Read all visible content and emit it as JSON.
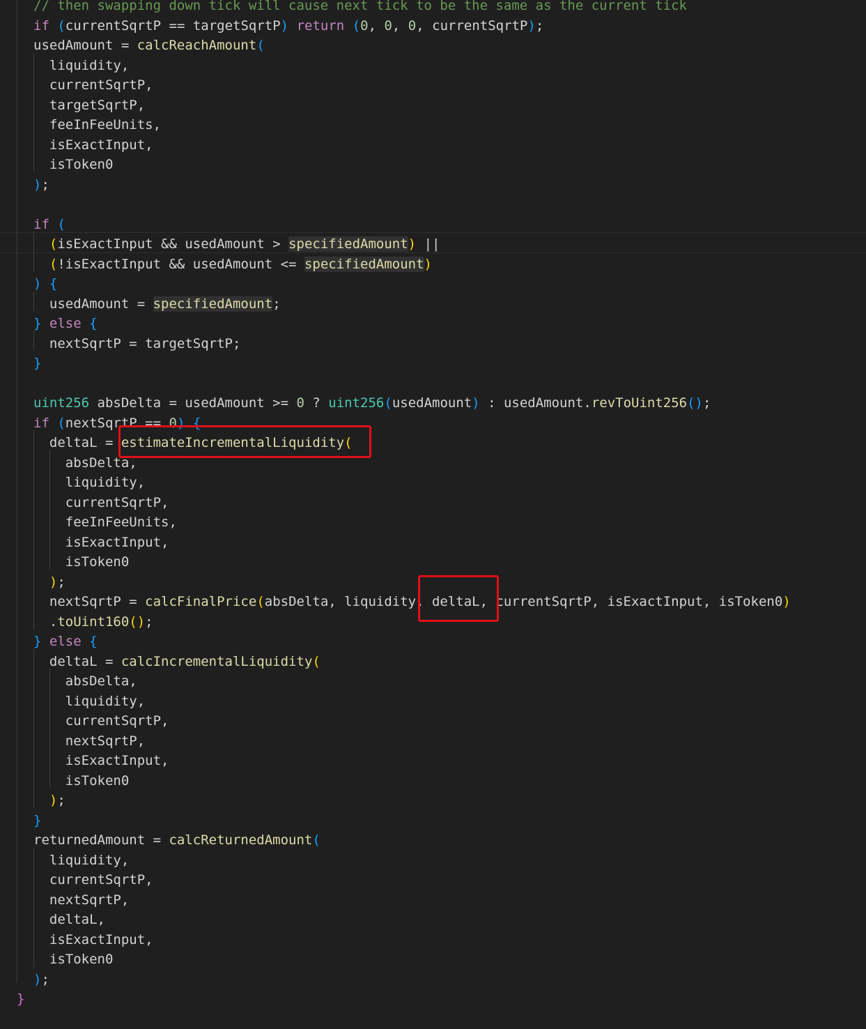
{
  "colors": {
    "background": "#1f1f1f",
    "keyword": "#c586c0",
    "function": "#dcdcaa",
    "type": "#4ec9b0",
    "number": "#b5cea8",
    "comment": "#6a9955",
    "bracket_level1": "#ffd700",
    "bracket_level2": "#da70d6",
    "bracket_level3": "#179fff",
    "annotation_box": "#e0101a"
  },
  "code": {
    "lines": [
      [
        {
          "t": "cmt",
          "v": "// then swapping down tick will cause next tick to be the same as the current tick"
        }
      ],
      [
        {
          "t": "kw",
          "v": "if"
        },
        {
          "t": "txt",
          "v": " "
        },
        {
          "t": "b3",
          "v": "("
        },
        {
          "t": "txt",
          "v": "currentSqrtP == targetSqrtP"
        },
        {
          "t": "b3",
          "v": ")"
        },
        {
          "t": "txt",
          "v": " "
        },
        {
          "t": "kw",
          "v": "return"
        },
        {
          "t": "txt",
          "v": " "
        },
        {
          "t": "b3",
          "v": "("
        },
        {
          "t": "num",
          "v": "0"
        },
        {
          "t": "txt",
          "v": ", "
        },
        {
          "t": "num",
          "v": "0"
        },
        {
          "t": "txt",
          "v": ", "
        },
        {
          "t": "num",
          "v": "0"
        },
        {
          "t": "txt",
          "v": ", currentSqrtP"
        },
        {
          "t": "b3",
          "v": ")"
        },
        {
          "t": "txt",
          "v": ";"
        }
      ],
      [
        {
          "t": "txt",
          "v": "usedAmount = "
        },
        {
          "t": "fn",
          "v": "calcReachAmount"
        },
        {
          "t": "b3",
          "v": "("
        }
      ],
      [
        {
          "t": "txt",
          "v": "  liquidity,"
        }
      ],
      [
        {
          "t": "txt",
          "v": "  currentSqrtP,"
        }
      ],
      [
        {
          "t": "txt",
          "v": "  targetSqrtP,"
        }
      ],
      [
        {
          "t": "txt",
          "v": "  feeInFeeUnits,"
        }
      ],
      [
        {
          "t": "txt",
          "v": "  isExactInput,"
        }
      ],
      [
        {
          "t": "txt",
          "v": "  isToken0"
        }
      ],
      [
        {
          "t": "b3",
          "v": ")"
        },
        {
          "t": "txt",
          "v": ";"
        }
      ],
      [],
      [
        {
          "t": "kw",
          "v": "if"
        },
        {
          "t": "txt",
          "v": " "
        },
        {
          "t": "b3",
          "v": "("
        }
      ],
      [
        {
          "t": "txt",
          "v": "  "
        },
        {
          "t": "b1",
          "v": "("
        },
        {
          "t": "txt",
          "v": "isExactInput && usedAmount > "
        },
        {
          "t": "mark",
          "v": "specifiedAmount"
        },
        {
          "t": "b1",
          "v": ")"
        },
        {
          "t": "txt",
          "v": " ||"
        }
      ],
      [
        {
          "t": "txt",
          "v": "  "
        },
        {
          "t": "b1",
          "v": "("
        },
        {
          "t": "txt",
          "v": "!isExactInput && usedAmount <= "
        },
        {
          "t": "mark",
          "v": "specifiedAmount"
        },
        {
          "t": "b1",
          "v": ")"
        }
      ],
      [
        {
          "t": "b3",
          "v": ")"
        },
        {
          "t": "txt",
          "v": " "
        },
        {
          "t": "b3",
          "v": "{"
        }
      ],
      [
        {
          "t": "txt",
          "v": "  usedAmount = "
        },
        {
          "t": "mark",
          "v": "specifiedAmount"
        },
        {
          "t": "txt",
          "v": ";"
        }
      ],
      [
        {
          "t": "b3",
          "v": "}"
        },
        {
          "t": "txt",
          "v": " "
        },
        {
          "t": "kw",
          "v": "else"
        },
        {
          "t": "txt",
          "v": " "
        },
        {
          "t": "b3",
          "v": "{"
        }
      ],
      [
        {
          "t": "txt",
          "v": "  nextSqrtP = targetSqrtP;"
        }
      ],
      [
        {
          "t": "b3",
          "v": "}"
        }
      ],
      [],
      [
        {
          "t": "type",
          "v": "uint256"
        },
        {
          "t": "txt",
          "v": " absDelta = usedAmount >= "
        },
        {
          "t": "num",
          "v": "0"
        },
        {
          "t": "txt",
          "v": " ? "
        },
        {
          "t": "type",
          "v": "uint256"
        },
        {
          "t": "b3",
          "v": "("
        },
        {
          "t": "txt",
          "v": "usedAmount"
        },
        {
          "t": "b3",
          "v": ")"
        },
        {
          "t": "txt",
          "v": " : usedAmount."
        },
        {
          "t": "fn",
          "v": "revToUint256"
        },
        {
          "t": "b3",
          "v": "()"
        },
        {
          "t": "txt",
          "v": ";"
        }
      ],
      [
        {
          "t": "kw",
          "v": "if"
        },
        {
          "t": "txt",
          "v": " "
        },
        {
          "t": "b3",
          "v": "("
        },
        {
          "t": "txt",
          "v": "nextSqrtP == "
        },
        {
          "t": "num",
          "v": "0"
        },
        {
          "t": "b3",
          "v": ")"
        },
        {
          "t": "txt",
          "v": " "
        },
        {
          "t": "b3",
          "v": "{"
        }
      ],
      [
        {
          "t": "txt",
          "v": "  deltaL = "
        },
        {
          "t": "fn",
          "v": "estimateIncrementalLiquidity"
        },
        {
          "t": "b1",
          "v": "("
        }
      ],
      [
        {
          "t": "txt",
          "v": "    absDelta,"
        }
      ],
      [
        {
          "t": "txt",
          "v": "    liquidity,"
        }
      ],
      [
        {
          "t": "txt",
          "v": "    currentSqrtP,"
        }
      ],
      [
        {
          "t": "txt",
          "v": "    feeInFeeUnits,"
        }
      ],
      [
        {
          "t": "txt",
          "v": "    isExactInput,"
        }
      ],
      [
        {
          "t": "txt",
          "v": "    isToken0"
        }
      ],
      [
        {
          "t": "txt",
          "v": "  "
        },
        {
          "t": "b1",
          "v": ")"
        },
        {
          "t": "txt",
          "v": ";"
        }
      ],
      [
        {
          "t": "txt",
          "v": "  nextSqrtP = "
        },
        {
          "t": "fn",
          "v": "calcFinalPrice"
        },
        {
          "t": "b1",
          "v": "("
        },
        {
          "t": "txt",
          "v": "absDelta, liquidity, deltaL, currentSqrtP, isExactInput, isToken0"
        },
        {
          "t": "b1",
          "v": ")"
        }
      ],
      [
        {
          "t": "txt",
          "v": "  ."
        },
        {
          "t": "fn",
          "v": "toUint160"
        },
        {
          "t": "b1",
          "v": "()"
        },
        {
          "t": "txt",
          "v": ";"
        }
      ],
      [
        {
          "t": "b3",
          "v": "}"
        },
        {
          "t": "txt",
          "v": " "
        },
        {
          "t": "kw",
          "v": "else"
        },
        {
          "t": "txt",
          "v": " "
        },
        {
          "t": "b3",
          "v": "{"
        }
      ],
      [
        {
          "t": "txt",
          "v": "  deltaL = "
        },
        {
          "t": "fn",
          "v": "calcIncrementalLiquidity"
        },
        {
          "t": "b1",
          "v": "("
        }
      ],
      [
        {
          "t": "txt",
          "v": "    absDelta,"
        }
      ],
      [
        {
          "t": "txt",
          "v": "    liquidity,"
        }
      ],
      [
        {
          "t": "txt",
          "v": "    currentSqrtP,"
        }
      ],
      [
        {
          "t": "txt",
          "v": "    nextSqrtP,"
        }
      ],
      [
        {
          "t": "txt",
          "v": "    isExactInput,"
        }
      ],
      [
        {
          "t": "txt",
          "v": "    isToken0"
        }
      ],
      [
        {
          "t": "txt",
          "v": "  "
        },
        {
          "t": "b1",
          "v": ")"
        },
        {
          "t": "txt",
          "v": ";"
        }
      ],
      [
        {
          "t": "b3",
          "v": "}"
        }
      ],
      [
        {
          "t": "txt",
          "v": "returnedAmount = "
        },
        {
          "t": "fn",
          "v": "calcReturnedAmount"
        },
        {
          "t": "b3",
          "v": "("
        }
      ],
      [
        {
          "t": "txt",
          "v": "  liquidity,"
        }
      ],
      [
        {
          "t": "txt",
          "v": "  currentSqrtP,"
        }
      ],
      [
        {
          "t": "txt",
          "v": "  nextSqrtP,"
        }
      ],
      [
        {
          "t": "txt",
          "v": "  deltaL,"
        }
      ],
      [
        {
          "t": "txt",
          "v": "  isExactInput,"
        }
      ],
      [
        {
          "t": "txt",
          "v": "  isToken0"
        }
      ],
      [
        {
          "t": "b3",
          "v": ")"
        },
        {
          "t": "txt",
          "v": ";"
        }
      ],
      [
        {
          "t": "b2",
          "v": "}"
        }
      ]
    ]
  }
}
